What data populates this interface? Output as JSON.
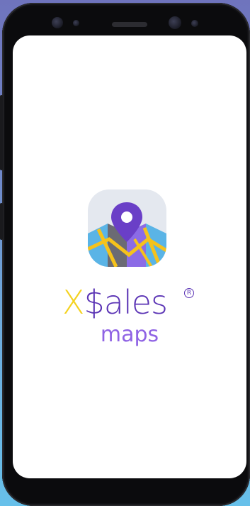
{
  "splash": {
    "brand_prefix": "X",
    "brand_suffix": "$ales",
    "registered_mark": "R",
    "subtitle": "maps"
  },
  "colors": {
    "brand_yellow": "#f4d21f",
    "brand_purple": "#5b34b5",
    "subtitle_purple": "#8f63e4",
    "logo_tile_bg": "#e4e8ef"
  },
  "icons": {
    "logo": "map-pin-icon"
  }
}
